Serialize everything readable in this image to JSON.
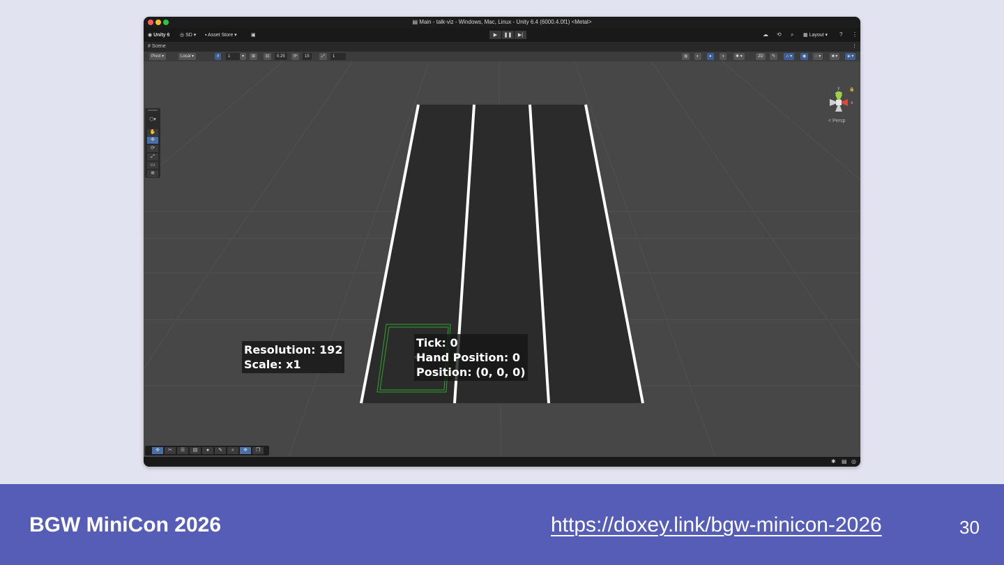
{
  "window": {
    "title": "Main - talk-viz - Windows, Mac, Linux - Unity 6.4 (6000.4.0f1) <Metal>"
  },
  "main_toolbar": {
    "unity_label": "Unity 6",
    "account_label": "SD",
    "asset_store_label": "Asset Store",
    "layout_label": "Layout"
  },
  "scene_tab": {
    "label": "Scene"
  },
  "scene_toolbar": {
    "pivot_label": "Pivot",
    "local_label": "Local",
    "grid_size_value": "1",
    "snap_increment_value": "0.25",
    "rotation_snap_value": "15",
    "scale_snap_value": "1"
  },
  "viewport": {
    "projection_label": "Persp",
    "gizmo_axes": {
      "y": "y",
      "x": "x"
    },
    "resolution_label": "Resolution: 192",
    "scale_label": "Scale: x1",
    "tick_label": "Tick: 0",
    "hand_position_label": "Hand Position: 0",
    "position_label": "Position: (0, 0, 0)"
  },
  "slide": {
    "title": "BGW MiniCon 2026",
    "url": "https://doxey.link/bgw-minicon-2026",
    "page_number": "30"
  },
  "colors": {
    "slide_background": "#e1e3f1",
    "footer_background": "#565db7",
    "unity_background": "#474747",
    "road": "#2b2b2b",
    "lane_line": "#ffffff",
    "selection_outline": "#2fa52f"
  }
}
